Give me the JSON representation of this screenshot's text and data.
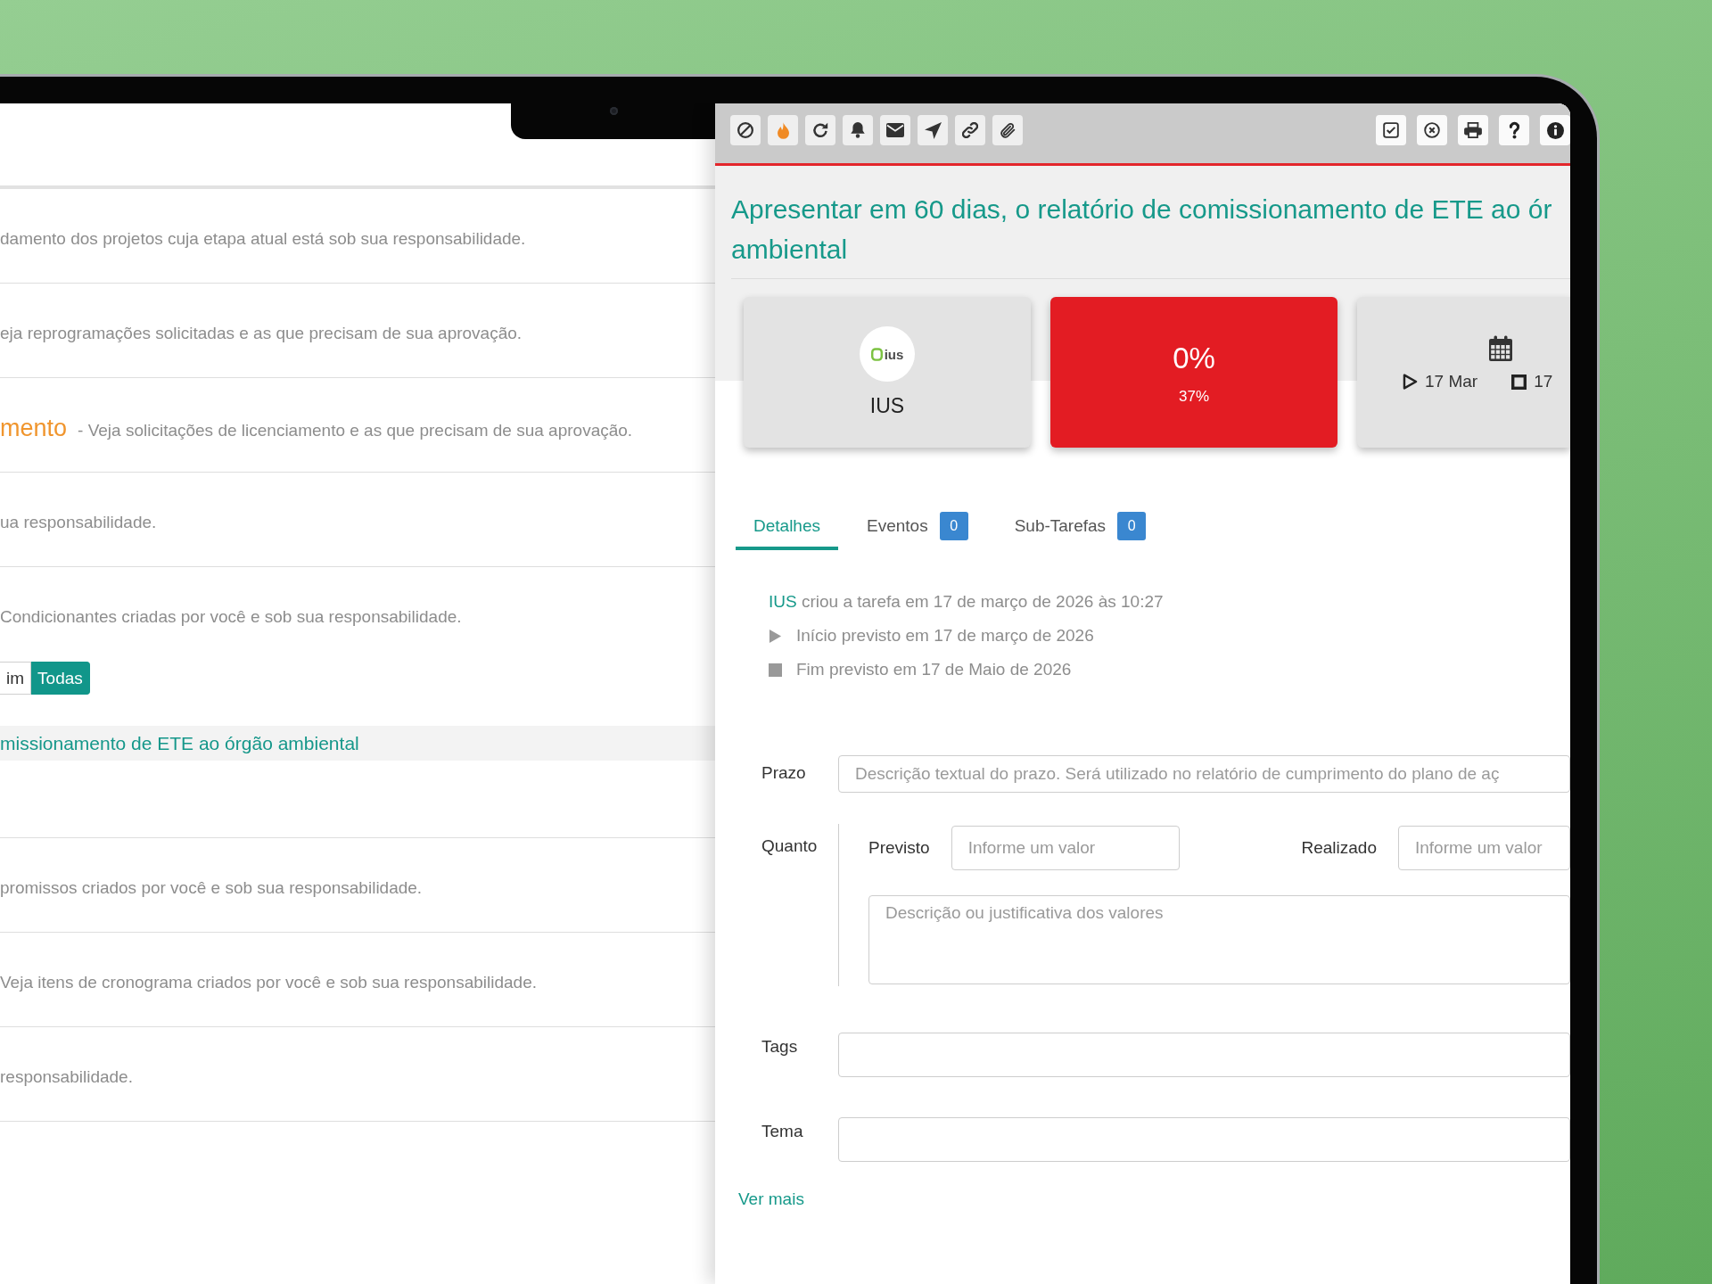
{
  "list": {
    "rows": [
      {
        "description": "damento dos projetos cuja etapa atual está sob sua responsabilidade."
      },
      {
        "description": "eja reprogramações solicitadas e as que precisam de sua aprovação."
      },
      {
        "title": "mento",
        "description": "- Veja solicitações de licenciamento e as que precisam de sua aprovação."
      },
      {
        "description": "ua responsabilidade."
      },
      {
        "description": "Condicionantes criadas por você e sob sua responsabilidade.",
        "filters": [
          {
            "label": "im",
            "selected": false
          },
          {
            "label": "Todas",
            "selected": true
          }
        ],
        "tasks": [
          {
            "title": "missionamento de ETE ao órgão ambiental",
            "selected": true
          }
        ]
      },
      {
        "description": "promissos criados por você e sob sua responsabilidade."
      },
      {
        "description": "Veja itens de cronograma criados por você e sob sua responsabilidade."
      },
      {
        "description": "responsabilidade."
      }
    ]
  },
  "task_panel": {
    "toolbar": {
      "left": [
        {
          "kind": "ban"
        },
        {
          "kind": "fire"
        },
        {
          "kind": "refresh"
        },
        {
          "kind": "bell"
        },
        {
          "kind": "mail"
        },
        {
          "kind": "send"
        },
        {
          "kind": "link"
        },
        {
          "kind": "attach"
        }
      ],
      "right": [
        {
          "kind": "check"
        },
        {
          "kind": "cancel"
        },
        {
          "kind": "print"
        },
        {
          "kind": "help"
        },
        {
          "kind": "info"
        }
      ]
    },
    "title": [
      "Apresentar em 60 dias, o relatório de comissionamento de ETE ao ór",
      "ambiental"
    ],
    "cards": [
      {
        "kind": "owner",
        "logo_text": "ius",
        "label": "IUS"
      },
      {
        "kind": "progress",
        "value": "0%",
        "expected": "37%",
        "color": "#e31c23"
      },
      {
        "kind": "dates",
        "start": "17 Mar",
        "end": "17"
      }
    ],
    "tabs": [
      {
        "label": "Detalhes",
        "selected": true
      },
      {
        "label": "Eventos",
        "count": "0",
        "selected": false
      },
      {
        "label": "Sub-Tarefas",
        "count": "0",
        "selected": false
      }
    ],
    "activity": {
      "author": "IUS",
      "text": "criou a tarefa em 17 de março de 2026 às 10:27",
      "start": "Início previsto em 17 de março de 2026",
      "end": "Fim previsto em 17 de Maio de 2026"
    },
    "fields": [
      {
        "kind": "text",
        "label": "Prazo",
        "placeholder": "Descrição textual do prazo. Será utilizado no relatório de cumprimento do plano de aç"
      },
      {
        "kind": "quantity",
        "label": "Quanto",
        "planned": {
          "label": "Previsto",
          "placeholder": "Informe um valor"
        },
        "actual": {
          "label": "Realizado",
          "placeholder": "Informe um valor"
        },
        "notes": {
          "placeholder": "Descrição ou justificativa dos valores"
        }
      },
      {
        "kind": "tags",
        "label": "Tags"
      },
      {
        "kind": "select",
        "label": "Tema"
      }
    ],
    "more_link": "Ver mais"
  }
}
